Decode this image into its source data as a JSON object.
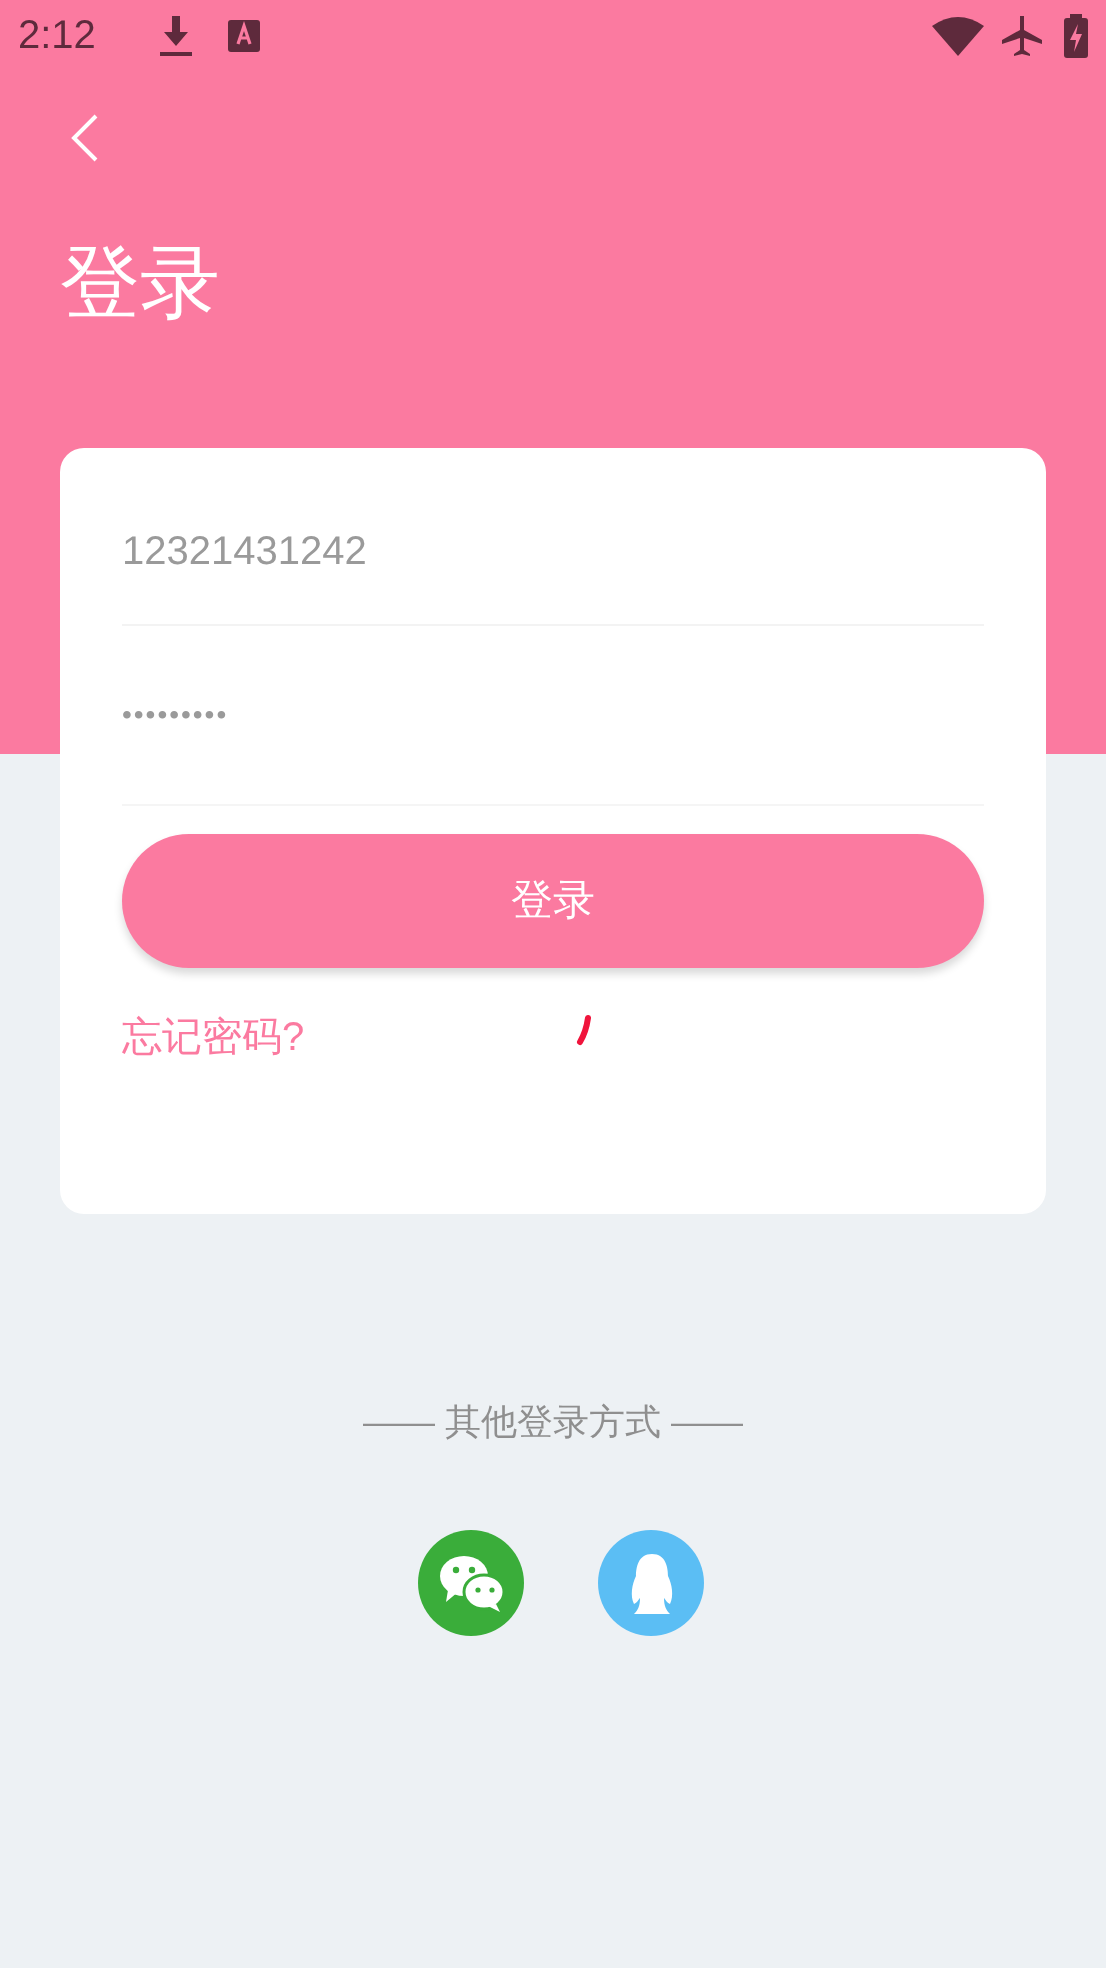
{
  "status_bar": {
    "time": "2:12"
  },
  "header": {
    "title": "登录"
  },
  "form": {
    "phone": "12321431242",
    "password": "•••••••••",
    "login_button": "登录",
    "forgot_link": "忘记密码?",
    "loading": true
  },
  "other_login": {
    "label": "—— 其他登录方式 ——",
    "options": [
      {
        "kind": "wechat",
        "color": "#3aad3a"
      },
      {
        "kind": "qq",
        "color": "#5bbef4"
      }
    ]
  }
}
